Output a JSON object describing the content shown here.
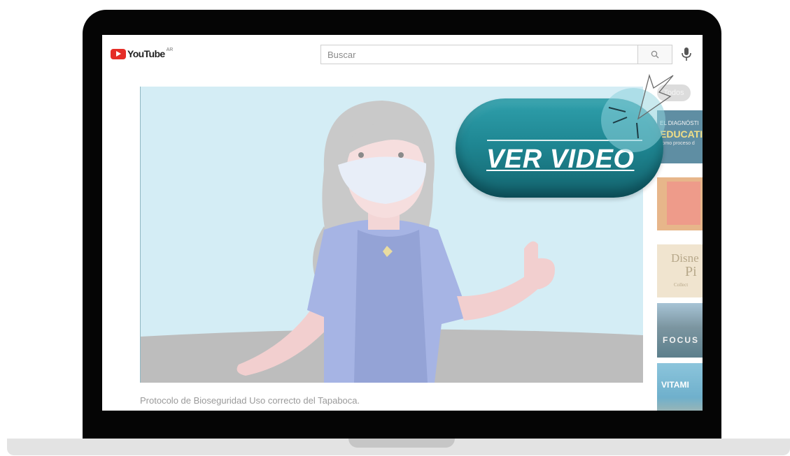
{
  "header": {
    "logo_text": "YouTube",
    "country_code": "AR",
    "search_placeholder": "Buscar"
  },
  "filter_chip": "Todos",
  "video": {
    "title": "Protocolo de Bioseguridad Uso correcto del Tapaboca."
  },
  "sidebar_thumbnails": [
    {
      "line1": "EL DIAGNÓSTI",
      "line2": "EDUCATIV",
      "line3": "como proceso d"
    },
    {
      "line1": "",
      "line2": "",
      "line3": ""
    },
    {
      "line1": "Disne",
      "line2": "Pi",
      "line3": "Collect"
    },
    {
      "line1": "FOCUS",
      "line2": "",
      "line3": ""
    },
    {
      "line1": "VITAMI",
      "line2": "",
      "line3": ""
    }
  ],
  "cta": {
    "label": "VER VIDEO"
  },
  "colors": {
    "cta_teal": "#1f8793",
    "youtube_red": "#e52d27",
    "player_bg": "#d2ecf4"
  }
}
